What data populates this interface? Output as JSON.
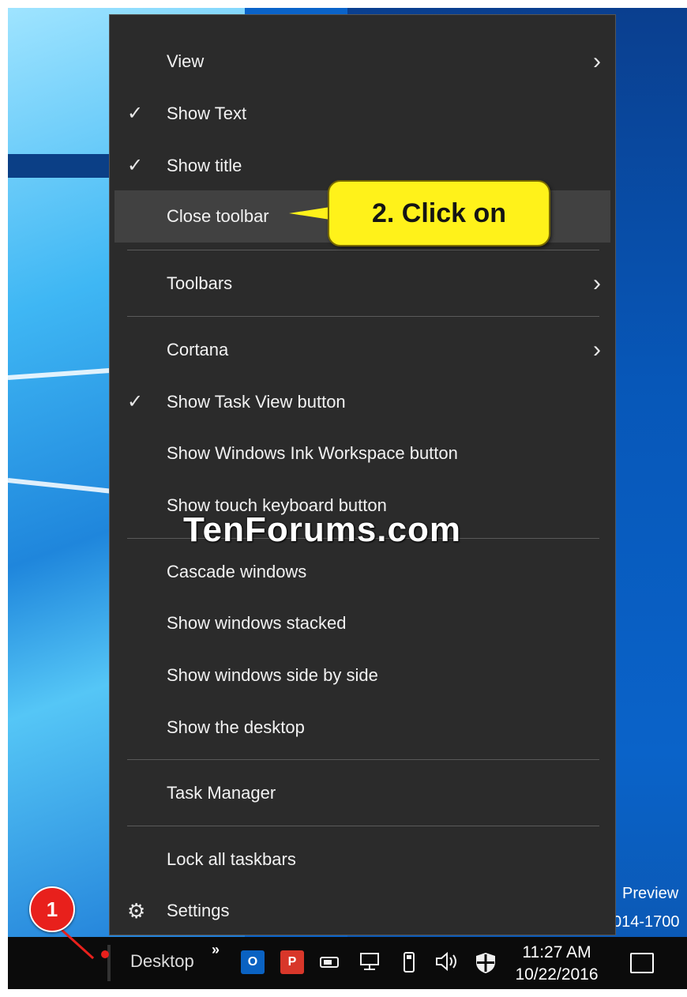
{
  "desktop": {
    "text_line1": "Preview",
    "text_line2": "014-1700"
  },
  "menu": {
    "items": [
      {
        "label": "View",
        "checked": false,
        "submenu": true
      },
      {
        "label": "Show Text",
        "checked": true,
        "submenu": false
      },
      {
        "label": "Show title",
        "checked": true,
        "submenu": false
      },
      {
        "label": "Close toolbar",
        "checked": false,
        "submenu": false,
        "highlighted": true
      },
      {
        "label": "Toolbars",
        "checked": false,
        "submenu": true
      },
      {
        "label": "Cortana",
        "checked": false,
        "submenu": true
      },
      {
        "label": "Show Task View button",
        "checked": true,
        "submenu": false
      },
      {
        "label": "Show Windows Ink Workspace button",
        "checked": false,
        "submenu": false
      },
      {
        "label": "Show touch keyboard button",
        "checked": false,
        "submenu": false
      },
      {
        "label": "Cascade windows",
        "checked": false,
        "submenu": false
      },
      {
        "label": "Show windows stacked",
        "checked": false,
        "submenu": false
      },
      {
        "label": "Show windows side by side",
        "checked": false,
        "submenu": false
      },
      {
        "label": "Show the desktop",
        "checked": false,
        "submenu": false
      },
      {
        "label": "Task Manager",
        "checked": false,
        "submenu": false
      },
      {
        "label": "Lock all taskbars",
        "checked": false,
        "submenu": false
      },
      {
        "label": "Settings",
        "checked": false,
        "submenu": false,
        "icon": "gear-icon"
      }
    ],
    "check_glyph": "✓",
    "arrow_glyph": "›",
    "gear_glyph": "⚙"
  },
  "annotations": {
    "callout_text": "2. Click on",
    "badge_text": "1",
    "watermark": "TenForums.com"
  },
  "taskbar": {
    "toolbar_label": "Desktop",
    "overflow_glyph": "»",
    "outlook_icon_text": "O",
    "app2_icon_text": "P",
    "time": "11:27 AM",
    "date": "10/22/2016"
  },
  "colors": {
    "menu_bg": "#2b2b2b",
    "menu_highlight": "#414141",
    "callout_bg": "#fff21a",
    "badge_red": "#e8201c",
    "taskbar_bg": "#0b0b0b"
  }
}
